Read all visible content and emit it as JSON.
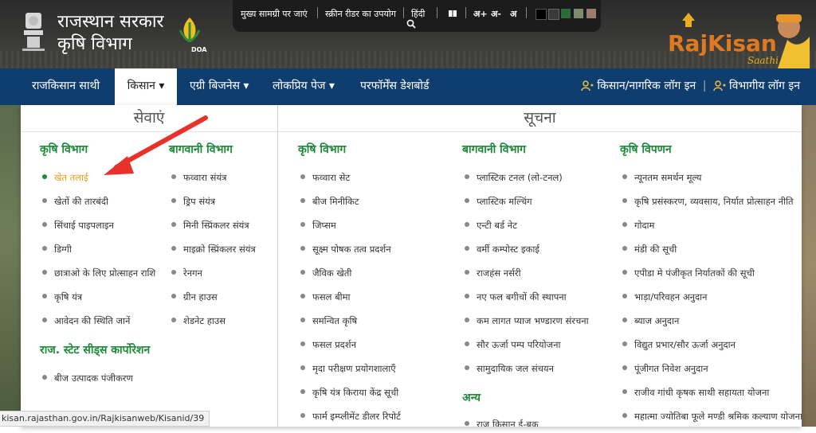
{
  "header": {
    "title_line1": "राजस्थान सरकार",
    "title_line2": "कृषि विभाग",
    "doa_label": "DOA",
    "access": {
      "skip": "मुख्य सामग्री पर जाएं",
      "screen_reader": "स्क्रीन रीडर का उपयोग",
      "hindi": "हिंदी",
      "font_plus": "अ+",
      "font_minus": "अ-",
      "font_normal": "अ"
    },
    "theme_colors": [
      "#000000",
      "#3a3a3a",
      "#2e6b3a",
      "#7c8c6c",
      "#9c7c6c"
    ],
    "rajkisan_logo": "RajKisan",
    "rajkisan_sub": "Saathi"
  },
  "nav": {
    "items": [
      {
        "label": "राजकिसान साथी"
      },
      {
        "label": "किसान ▾"
      },
      {
        "label": "एग्री बिजनेस ▾"
      },
      {
        "label": "लोकप्रिय पेज ▾"
      },
      {
        "label": "परफॉर्मेंस डेशबोर्ड"
      }
    ],
    "login_citizen": "किसान/नागरिक लॉग इन",
    "login_dept": "विभागीय लॉग इन"
  },
  "menu": {
    "services_head": "सेवाएं",
    "info_head": "सूचना",
    "columns": {
      "krishi": {
        "title": "कृषि विभाग",
        "items": [
          "खेत तलाई",
          "खेतों की तारबंदी",
          "सिंचाई पाइपलाइन",
          "डिग्गी",
          "छात्राओ के लिए प्रोत्साहन राशि",
          "कृषि यंत्र",
          "आवेदन की स्थिति जानें"
        ]
      },
      "seeds": {
        "title": "राज. स्टेट सीड्स कार्पोरेशन",
        "items": [
          "बीज उत्पादक पंजीकरण"
        ]
      },
      "horti": {
        "title": "बागवानी विभाग",
        "items": [
          "फव्वारा संयंत्र",
          "ड्रिप संयंत्र",
          "मिनी स्प्रिंकलर संयंत्र",
          "माइक्रो स्प्रिंकलर संयंत्र",
          "रेनगन",
          "ग्रीन हाउस",
          "शेडनेट हाउस"
        ]
      },
      "info_krishi": {
        "title": "कृषि विभाग",
        "items": [
          "फव्वारा सेट",
          "बीज मिनीकिट",
          "जिप्सम",
          "सूक्ष्म पोषक तत्व प्रदर्शन",
          "जैविक खेती",
          "फसल बीमा",
          "समन्वित कृषि",
          "फसल प्रदर्शन",
          "मृदा परीक्षण प्रयोगशालाएँ",
          "कृषि यंत्र किराया केंद्र सूची",
          "फार्म इम्प्लीमेंट डीलर रिपोर्ट"
        ]
      },
      "info_horti": {
        "title": "बागवानी विभाग",
        "items": [
          "प्लास्टिक टनल (लो-टनल)",
          "प्लास्टिक मल्चिंग",
          "एन्टी बर्ड नेट",
          "वर्मी कम्पोस्ट इकाई",
          "राजहंस नर्सरी",
          "नए फल बगीचों की स्थापना",
          "कम लागत प्याज भण्डारण संरचना",
          "सौर ऊर्जा पम्प परियोजना",
          "सामुदायिक जल संचयन"
        ]
      },
      "info_other": {
        "title": "अन्य",
        "items": [
          "राज किसान ई-बुक"
        ]
      },
      "info_market": {
        "title": "कृषि विपणन",
        "items": [
          "न्यूनतम समर्थन मूल्य",
          "कृषि प्रसंस्करण, व्यवसाय, निर्यात प्रोत्साहन नीति",
          "गोदाम",
          "मंडी की सूची",
          "एपीडा मे पंजीकृत निर्यातकों की सूची",
          "भाड़ा/परिवहन अनुदान",
          "ब्याज अनुदान",
          "विद्युत प्रभार/सौर ऊर्जा अनुदान",
          "पूंजीगत निवेश अनुदान",
          "राजीव गांधी कृषक साथी सहायता योजना",
          "महात्मा ज्योतिबा फूले मण्डी श्रमिक कल्याण योजना"
        ]
      }
    }
  },
  "status_url": "kisan.rajasthan.gov.in/Rajkisanweb/Kisanid/39"
}
